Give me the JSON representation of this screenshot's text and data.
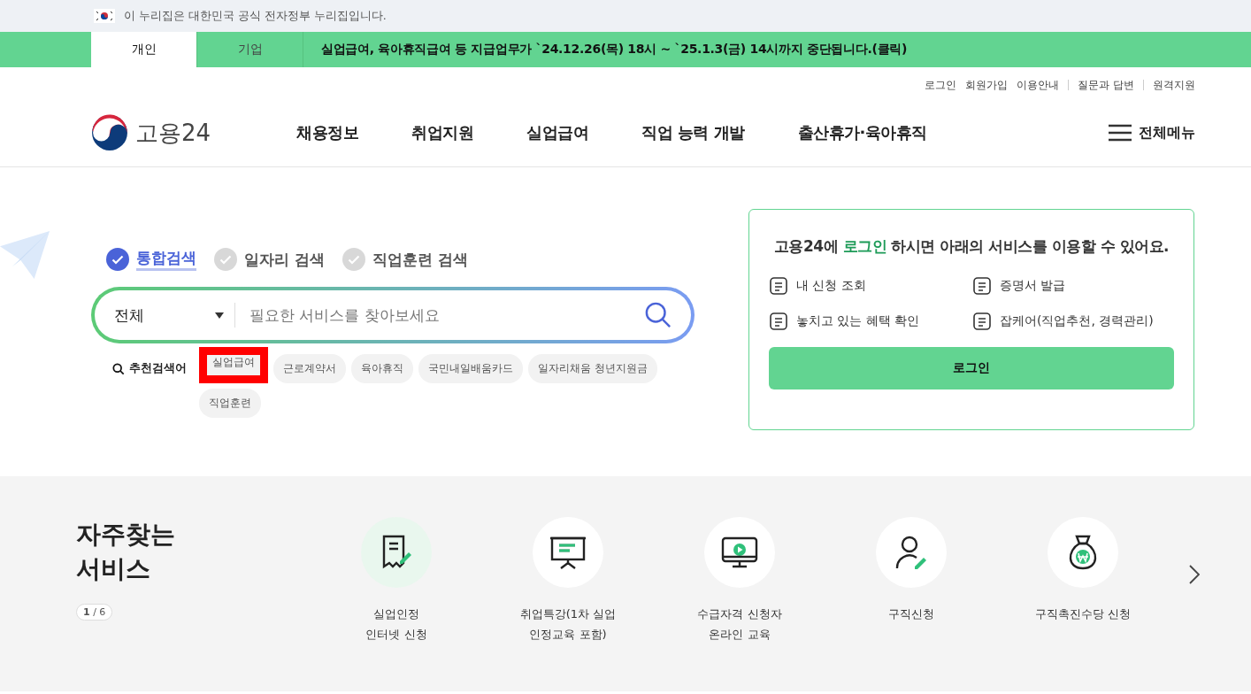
{
  "gov_banner": {
    "text": "이 누리집은 대한민국 공식 전자정부 누리집입니다."
  },
  "audience_tabs": [
    {
      "label": "개인",
      "selected": true
    },
    {
      "label": "기업",
      "selected": false
    }
  ],
  "notice": "실업급여, 육아휴직급여 등 지급업무가 `24.12.26(목) 18시 ~ `25.1.3(금) 14시까지 중단됩니다.(클릭)",
  "util_links": [
    "로그인",
    "회원가입",
    "이용안내",
    "질문과 답변",
    "원격지원"
  ],
  "logo": {
    "text": "고용24"
  },
  "nav": [
    "채용정보",
    "취업지원",
    "실업급여",
    "직업 능력 개발",
    "출산휴가·육아휴직"
  ],
  "all_menu": "전체메뉴",
  "search_tabs": [
    {
      "label": "통합검색",
      "selected": true
    },
    {
      "label": "일자리 검색",
      "selected": false
    },
    {
      "label": "직업훈련 검색",
      "selected": false
    }
  ],
  "search": {
    "category": "전체",
    "placeholder": "필요한 서비스를 찾아보세요"
  },
  "recommended": {
    "label": "추천검색어",
    "keywords": [
      {
        "text": "실업급여",
        "highlighted": true
      },
      {
        "text": "근로계약서",
        "highlighted": false
      },
      {
        "text": "육아휴직",
        "highlighted": false
      },
      {
        "text": "국민내일배움카드",
        "highlighted": false
      },
      {
        "text": "일자리채움 청년지원금",
        "highlighted": false
      },
      {
        "text": "직업훈련",
        "highlighted": false
      }
    ]
  },
  "login_panel": {
    "title": "고용24에 **로그인** 하시면 아래의 서비스를 이용할 수 있어요.",
    "services": [
      "내 신청 조회",
      "증명서 발급",
      "놓치고 있는 혜택 확인",
      "잡케어(직업추천, 경력관리)"
    ],
    "button": "로그인"
  },
  "frequent_services": {
    "title": "자주찾는 서비스",
    "pager": "**1** / 6",
    "items": [
      {
        "label": "실업인정\n인터넷 신청",
        "selected": true
      },
      {
        "label": "취업특강(1차 실업\n인정교육 포함)",
        "selected": false
      },
      {
        "label": "수급자격 신청자\n온라인 교육",
        "selected": false
      },
      {
        "label": "구직신청",
        "selected": false
      },
      {
        "label": "구직촉진수당 신청",
        "selected": false
      }
    ]
  }
}
